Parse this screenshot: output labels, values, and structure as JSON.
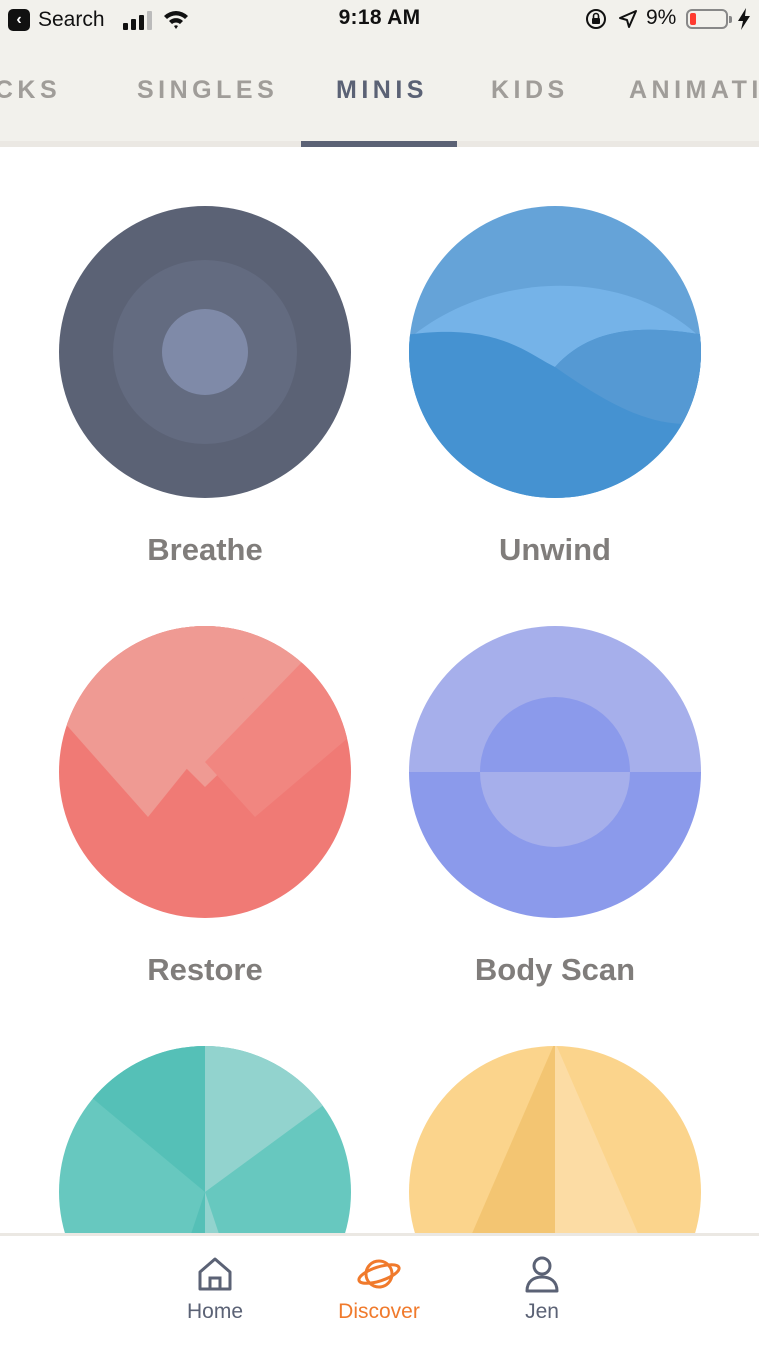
{
  "status_bar": {
    "back_label": "Search",
    "time": "9:18 AM",
    "battery_percent": "9%",
    "icons": [
      "back-icon",
      "signal-icon",
      "wifi-icon",
      "rotation-lock-icon",
      "location-icon",
      "battery-icon",
      "charging-bolt-icon"
    ]
  },
  "tabs": {
    "items": [
      {
        "label": "PACKS"
      },
      {
        "label": "SINGLES"
      },
      {
        "label": "MINIS"
      },
      {
        "label": "KIDS"
      },
      {
        "label": "ANIMATIONS"
      }
    ],
    "active": "MINIS"
  },
  "minis": [
    {
      "title": "Breathe",
      "colors": [
        "#5b6275",
        "#636b80",
        "#7f8aa8"
      ]
    },
    {
      "title": "Unwind",
      "colors": [
        "#65a3d8",
        "#75b3e8",
        "#4592d1",
        "#5599d3"
      ]
    },
    {
      "title": "Restore",
      "colors": [
        "#f07a75",
        "#ef9a93",
        "#f18680"
      ]
    },
    {
      "title": "Body Scan",
      "colors": [
        "#a6afeb",
        "#8b9aeb"
      ]
    },
    {
      "title": "",
      "colors": [
        "#67c8bf",
        "#55c0b7",
        "#92d3ce"
      ]
    },
    {
      "title": "",
      "colors": [
        "#fbd48c",
        "#f3c572",
        "#fcdca4"
      ]
    }
  ],
  "bottom_nav": {
    "items": [
      {
        "label": "Home",
        "icon": "home-icon"
      },
      {
        "label": "Discover",
        "icon": "planet-icon"
      },
      {
        "label": "Jen",
        "icon": "person-icon"
      }
    ],
    "active": "Discover",
    "active_color": "#f07a2c",
    "inactive_color": "#5b6275"
  }
}
